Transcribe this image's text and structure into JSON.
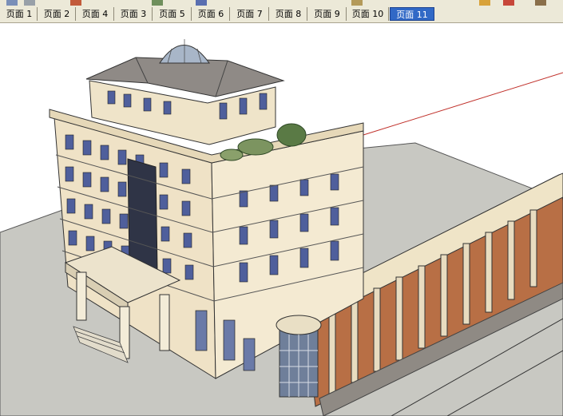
{
  "page_tabs": [
    {
      "label": "页面 1",
      "active": false
    },
    {
      "label": "页面 2",
      "active": false
    },
    {
      "label": "页面 4",
      "active": false
    },
    {
      "label": "页面 3",
      "active": false
    },
    {
      "label": "页面 5",
      "active": false
    },
    {
      "label": "页面 6",
      "active": false
    },
    {
      "label": "页面 7",
      "active": false
    },
    {
      "label": "页面 8",
      "active": false
    },
    {
      "label": "页面 9",
      "active": false
    },
    {
      "label": "页面 10",
      "active": false
    },
    {
      "label": "页面 11",
      "active": true
    }
  ],
  "colors": {
    "chrome": "#ece9d8",
    "active_tab": "#3169c6",
    "ground": "#c9c9c3",
    "facade": "#f1e7cf",
    "roof": "#8f8a86",
    "window": "#4f5f9c",
    "brick": "#a3633e",
    "axis_red": "#c0302a"
  },
  "viewport": {
    "content": "sketchup-model-view"
  }
}
